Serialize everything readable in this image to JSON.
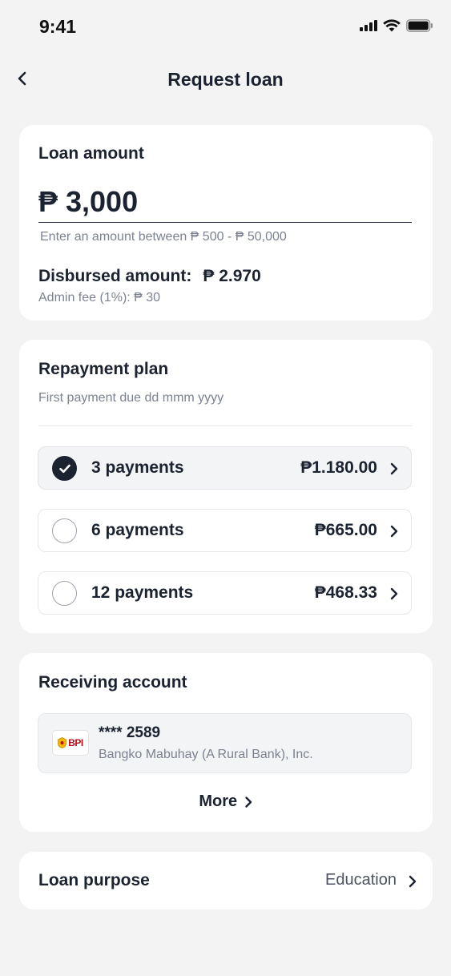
{
  "status_bar": {
    "time": "9:41",
    "icons": [
      "signal-icon",
      "wifi-icon",
      "battery-icon"
    ]
  },
  "nav": {
    "title": "Request loan",
    "back_icon": "chevron-left-icon"
  },
  "loan_amount": {
    "title": "Loan amount",
    "value": "₱ 3,000",
    "helper": "Enter an amount between ₱ 500 - ₱ 50,000",
    "disbursed_label": "Disbursed amount:",
    "disbursed_value": "₱ 2.970",
    "admin_fee": "Admin fee (1%):  ₱ 30"
  },
  "repayment_plan": {
    "title": "Repayment plan",
    "subtitle": "First payment due dd mmm yyyy",
    "options": [
      {
        "label": "3 payments",
        "amount": "₱1.180.00",
        "selected": true
      },
      {
        "label": "6 payments",
        "amount": "₱665.00",
        "selected": false
      },
      {
        "label": "12 payments",
        "amount": "₱468.33",
        "selected": false
      }
    ]
  },
  "receiving_account": {
    "title": "Receiving account",
    "bank_logo_text": "BPI",
    "account_number": "**** 2589",
    "bank_name": "Bangko Mabuhay (A Rural Bank), Inc.",
    "more_label": "More"
  },
  "loan_purpose": {
    "label": "Loan purpose",
    "value": "Education"
  },
  "colors": {
    "background": "#f3f3f3",
    "card": "#ffffff",
    "text": "#1b2230",
    "muted": "#7c8291",
    "brand_red": "#b5121b"
  }
}
